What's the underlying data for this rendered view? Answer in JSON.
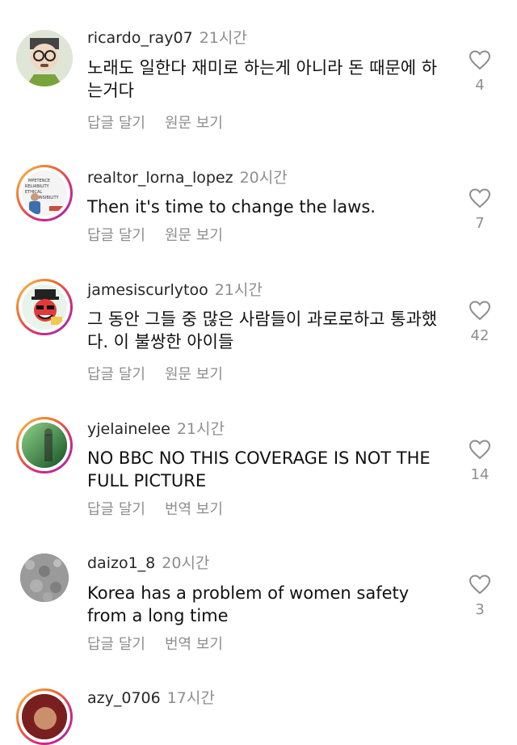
{
  "comments": [
    {
      "username": "ricardo_ray07",
      "time": "21시간",
      "text": "노래도 일한다 재미로 하는게 아니라 돈 때문에 하는거다",
      "reply": "답글 달기",
      "secondary": "원문 보기",
      "likes": "4",
      "avatar_icon": "cartoon-avatar"
    },
    {
      "username": "realtor_lorna_lopez",
      "time": "20시간",
      "text": "Then it's time to change the laws.",
      "reply": "답글 달기",
      "secondary": "원문 보기",
      "likes": "7",
      "avatar_icon": "poster-avatar",
      "avatar_text": [
        "MPETENCE",
        "RELIABILITY",
        "ETHICAL",
        "ONSIBILITY"
      ]
    },
    {
      "username": "jamesiscurlytoo",
      "time": "21시간",
      "text": "그 동안 그들 중 많은 사람들이 과로로하고 통과했다. 이 불쌍한 아이들",
      "reply": "답글 달기",
      "secondary": "원문 보기",
      "likes": "42",
      "avatar_icon": "cartoon-face-avatar"
    },
    {
      "username": "yjelainelee",
      "time": "21시간",
      "text": "NO BBC NO THIS COVERAGE IS NOT THE FULL PICTURE",
      "reply": "답글 달기",
      "secondary": "번역 보기",
      "likes": "14",
      "avatar_icon": "photo-avatar"
    },
    {
      "username": "daizo1_8",
      "time": "20시간",
      "text": "Korea has a problem of women safety from a long time",
      "reply": "답글 달기",
      "secondary": "번역 보기",
      "likes": "3",
      "avatar_icon": "texture-avatar"
    },
    {
      "username": "azy_0706",
      "time": "17시간",
      "avatar_icon": "partial-avatar"
    }
  ],
  "colors": {
    "text": "#111111",
    "muted": "#8e8e8e",
    "username": "#262626"
  }
}
